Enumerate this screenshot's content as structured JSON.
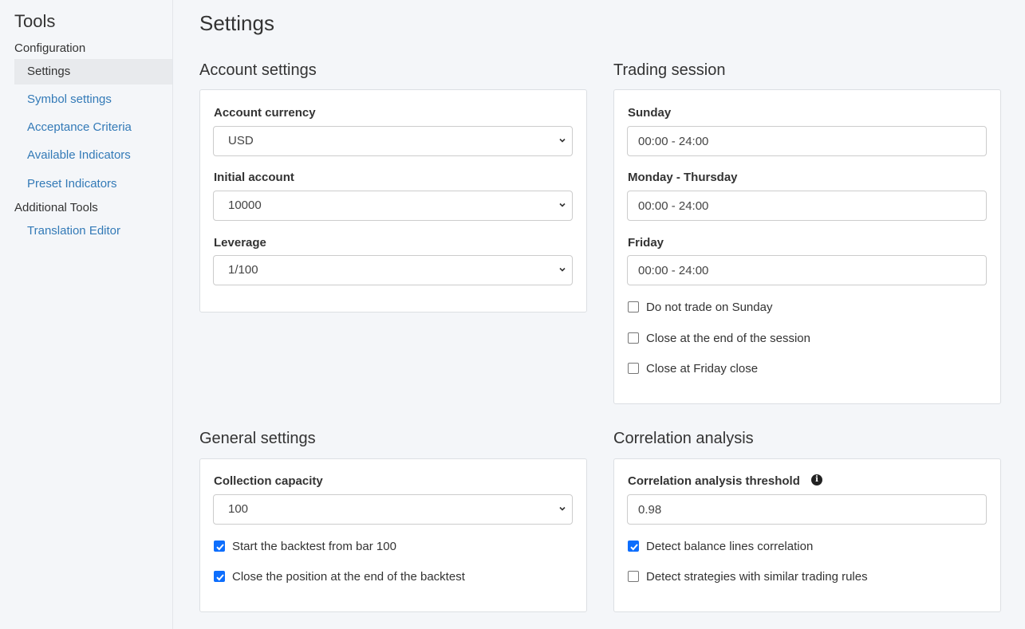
{
  "sidebar": {
    "title": "Tools",
    "groups": [
      {
        "label": "Configuration"
      },
      {
        "label": "Additional Tools"
      }
    ],
    "items": [
      {
        "label": "Settings"
      },
      {
        "label": "Symbol settings"
      },
      {
        "label": "Acceptance Criteria"
      },
      {
        "label": "Available Indicators"
      },
      {
        "label": "Preset Indicators"
      },
      {
        "label": "Translation Editor"
      }
    ]
  },
  "page": {
    "title": "Settings"
  },
  "account": {
    "title": "Account settings",
    "currency_label": "Account currency",
    "currency_value": "USD",
    "initial_label": "Initial account",
    "initial_value": "10000",
    "leverage_label": "Leverage",
    "leverage_value": "1/100"
  },
  "session": {
    "title": "Trading session",
    "sunday_label": "Sunday",
    "sunday_value": "00:00 - 24:00",
    "monthu_label": "Monday - Thursday",
    "monthu_value": "00:00 - 24:00",
    "friday_label": "Friday",
    "friday_value": "00:00 - 24:00",
    "opt_no_sunday": {
      "label": "Do not trade on Sunday",
      "checked": false
    },
    "opt_close_session": {
      "label": "Close at the end of the session",
      "checked": false
    },
    "opt_close_friday": {
      "label": "Close at Friday close",
      "checked": false
    }
  },
  "general": {
    "title": "General settings",
    "capacity_label": "Collection capacity",
    "capacity_value": "100",
    "opt_start_bar": {
      "label": "Start the backtest from bar 100",
      "checked": true
    },
    "opt_close_end": {
      "label": "Close the position at the end of the backtest",
      "checked": true
    }
  },
  "correlation": {
    "title": "Correlation analysis",
    "threshold_label": "Correlation analysis threshold",
    "threshold_value": "0.98",
    "opt_balance": {
      "label": "Detect balance lines correlation",
      "checked": true
    },
    "opt_similar": {
      "label": "Detect strategies with similar trading rules",
      "checked": false
    }
  },
  "colors": {
    "link": "#337ab7",
    "checkbox": "#0d6efd",
    "background": "#f4f6f9"
  },
  "icons": [
    "chevron-down-icon",
    "check-icon",
    "info-icon"
  ]
}
